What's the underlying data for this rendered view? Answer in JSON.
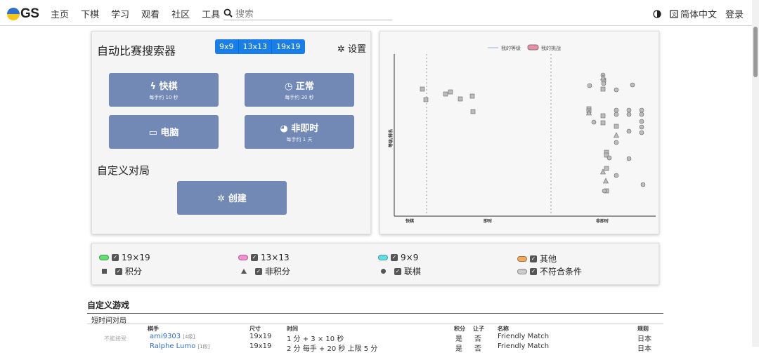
{
  "app": {
    "logo_text": "GS"
  },
  "nav": {
    "items": [
      "主页",
      "下棋",
      "学习",
      "观看",
      "社区",
      "工具"
    ]
  },
  "search": {
    "placeholder": "搜索"
  },
  "right": {
    "language": "简体中文",
    "login": "登录"
  },
  "finder": {
    "title": "自动比赛搜索器",
    "sizes": [
      "9x9",
      "13x13",
      "19x19"
    ],
    "settings_label": "设置",
    "buttons": [
      {
        "label": "快棋",
        "sub": "每手约 10 秒",
        "icon": "lightning-icon"
      },
      {
        "label": "正常",
        "sub": "每手约 30 秒",
        "icon": "clock-icon"
      },
      {
        "label": "电脑",
        "sub": "",
        "icon": "monitor-icon"
      },
      {
        "label": "非即时",
        "sub": "每手约 1 天",
        "icon": "snail-icon"
      }
    ],
    "custom_title": "自定义对局",
    "create_label": "创建"
  },
  "chart": {
    "legend": [
      "我的等级",
      "我的挑战"
    ],
    "ylabel": "等级/排名",
    "xticks": [
      "快棋",
      "即时",
      "非即时"
    ],
    "colors": {
      "mine": "#9ab0e0",
      "challenge": "#f08ca8"
    }
  },
  "filters": {
    "items": [
      {
        "label": "19×19",
        "color": "#5fe06f"
      },
      {
        "label": "13×13",
        "color": "#f390d2"
      },
      {
        "label": "9×9",
        "color": "#5fe0e8"
      },
      {
        "label": "其他",
        "color": "#f2a85a"
      },
      {
        "label": "积分",
        "shape": "square"
      },
      {
        "label": "非积分",
        "shape": "triangle"
      },
      {
        "label": "联棋",
        "shape": "circle"
      },
      {
        "label": "不符合条件",
        "color": "#cccccc"
      }
    ]
  },
  "games": {
    "title": "自定义游戏",
    "section": "短时间对局",
    "headers": [
      "棋手",
      "尺寸",
      "时间",
      "积分",
      "让子",
      "名称",
      "规则"
    ],
    "rows": [
      {
        "status": "不能接受",
        "player": "ami9303",
        "rank": "[4级]",
        "size": "19x19",
        "time": "1 分 + 3 × 10 秒",
        "rated": "是",
        "handicap": "否",
        "name": "Friendly Match",
        "rules": "日本"
      },
      {
        "status": "",
        "player": "Ralphe Lumo",
        "rank": "[1段]",
        "size": "19x19",
        "time": "2 分 每手 + 20 秒 上限 5 分",
        "rated": "是",
        "handicap": "否",
        "name": "Friendly Match",
        "rules": "日本"
      }
    ]
  }
}
